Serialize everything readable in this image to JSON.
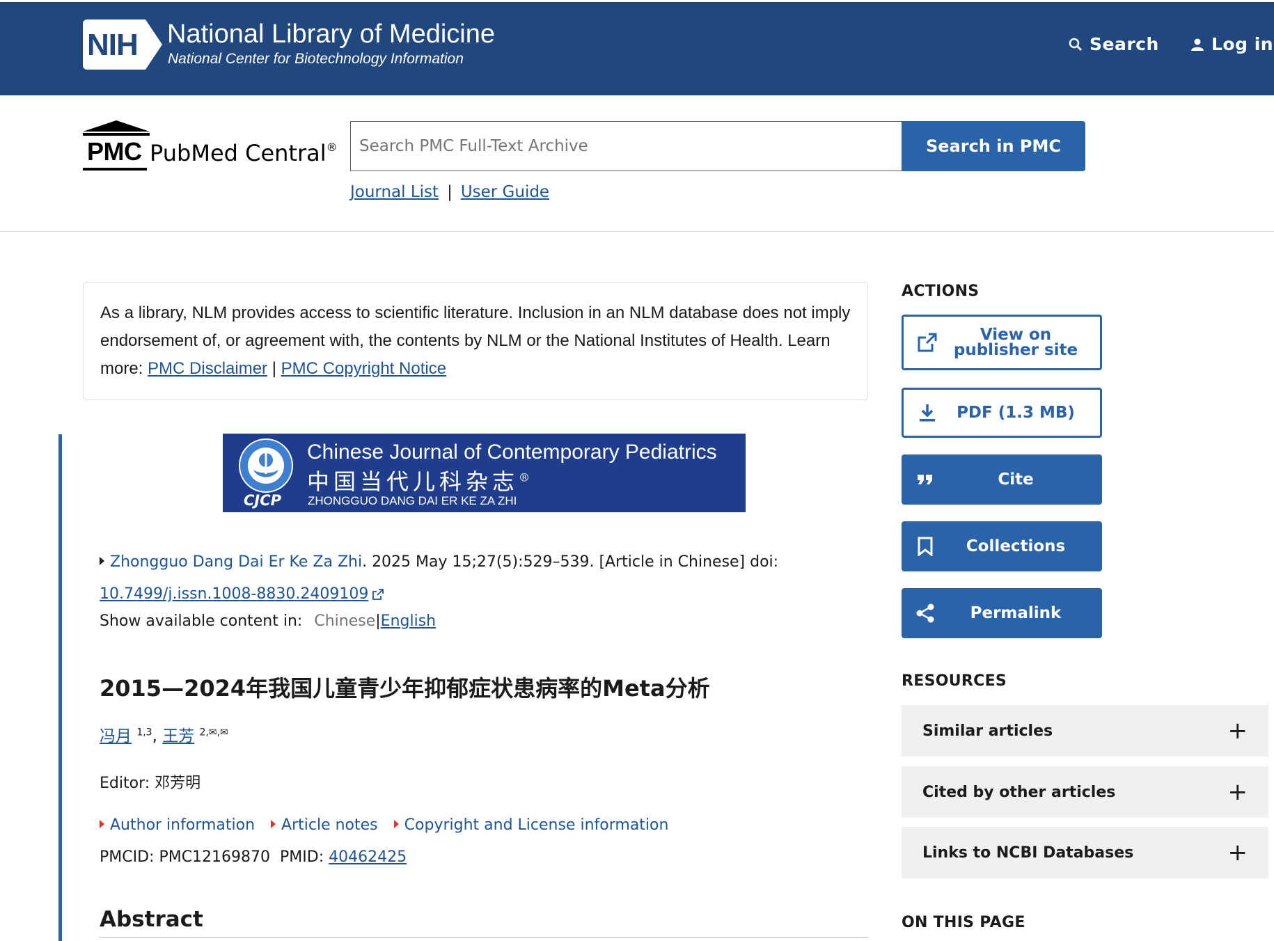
{
  "nih": {
    "logo_text": "NIH",
    "title": "National Library of Medicine",
    "subtitle": "National Center for Biotechnology Information",
    "search_label": "Search",
    "login_label": "Log in"
  },
  "pmc": {
    "logo_abbr": "PMC",
    "logo_name": "PubMed Central",
    "logo_reg": "®",
    "search_placeholder": "Search PMC Full-Text Archive",
    "search_button": "Search in PMC",
    "journal_list": "Journal List",
    "separator": "|",
    "user_guide": "User Guide"
  },
  "disclaimer": {
    "text": "As a library, NLM provides access to scientific literature. Inclusion in an NLM database does not imply endorsement of, or agreement with, the contents by NLM or the National Institutes of Health.",
    "learn_more": "Learn more:",
    "link1": "PMC Disclaimer",
    "sep": "|",
    "link2": "PMC Copyright Notice"
  },
  "journal_banner": {
    "title_en": "Chinese Journal of Contemporary Pediatrics",
    "title_cn": "中国当代儿科杂志",
    "reg": "®",
    "pinyin": "ZHONGGUO DANG DAI ER KE ZA ZHI",
    "abbr": "CJCP"
  },
  "citation": {
    "journal": "Zhongguo Dang Dai Er Ke Za Zhi",
    "details": ". 2025 May 15;27(5):529–539. [Article in Chinese] doi: ",
    "doi": "10.7499/j.issn.1008-8830.2409109"
  },
  "language": {
    "label": "Show available content in:",
    "current": "Chinese",
    "sep": "|",
    "other": "English"
  },
  "article": {
    "title": "2015—2024年我国儿童青少年抑郁症状患病率的Meta分析",
    "authors": [
      {
        "name": "冯月",
        "sup": "1,3"
      },
      {
        "name": "王芳",
        "sup": "2,✉,✉"
      }
    ],
    "comma": ",",
    "editor_label": "Editor:",
    "editor_name": "邓芳明",
    "info_links": [
      "Author information",
      "Article notes",
      "Copyright and License information"
    ],
    "pmcid_label": "PMCID: PMC12169870",
    "pmid_label": "PMID:",
    "pmid": "40462425",
    "abstract_heading": "Abstract"
  },
  "sidebar": {
    "actions_heading": "ACTIONS",
    "actions": [
      {
        "label": "View on publisher site",
        "icon": "external-link-icon"
      },
      {
        "label": "PDF (1.3 MB)",
        "icon": "download-icon"
      },
      {
        "label": "Cite",
        "icon": "quote-icon"
      },
      {
        "label": "Collections",
        "icon": "bookmark-icon"
      },
      {
        "label": "Permalink",
        "icon": "share-icon"
      }
    ],
    "resources_heading": "RESOURCES",
    "resources": [
      "Similar articles",
      "Cited by other articles",
      "Links to NCBI Databases"
    ],
    "on_this_page_heading": "ON THIS PAGE"
  },
  "colors": {
    "nih_blue": "#20477e",
    "pmc_blue": "#2b63a8",
    "link": "#205493",
    "accent_red": "#d83933"
  }
}
